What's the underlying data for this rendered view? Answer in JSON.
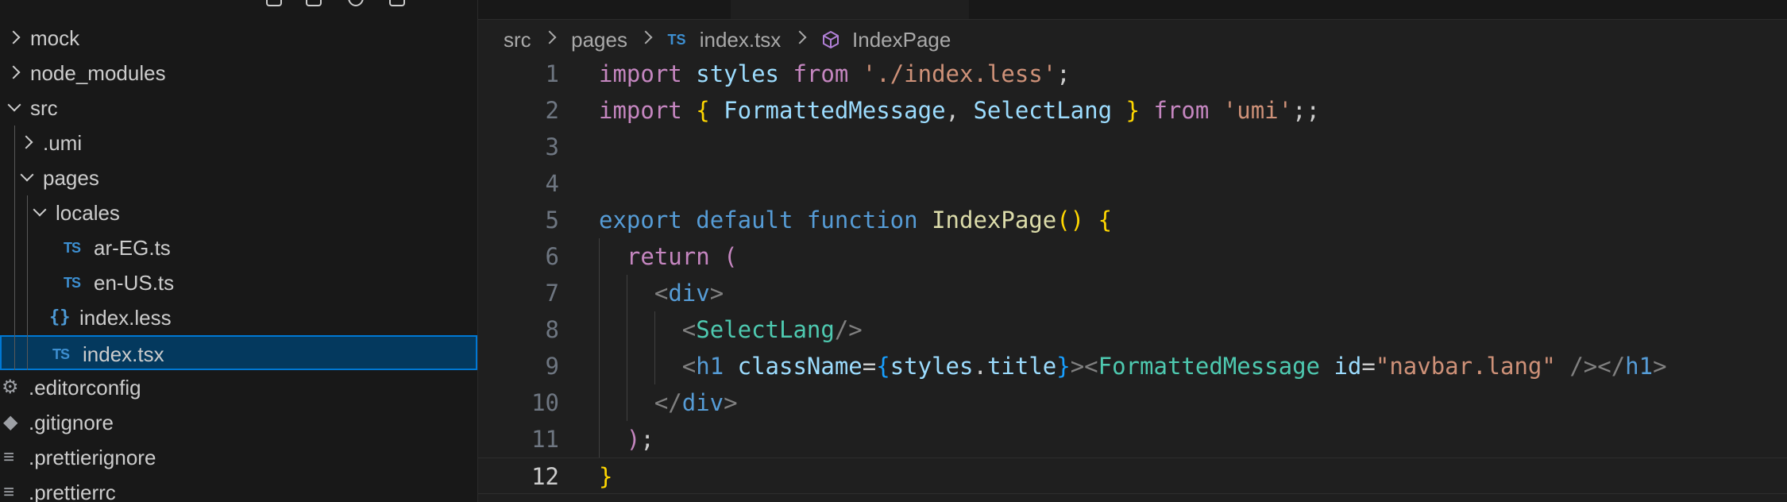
{
  "explorer": {
    "items": [
      {
        "label": "mock",
        "kind": "folder",
        "state": "closed",
        "depth": 0
      },
      {
        "label": "node_modules",
        "kind": "folder",
        "state": "closed",
        "depth": 0
      },
      {
        "label": "src",
        "kind": "folder",
        "state": "open",
        "depth": 0
      },
      {
        "label": ".umi",
        "kind": "folder",
        "state": "closed",
        "depth": 1
      },
      {
        "label": "pages",
        "kind": "folder",
        "state": "open",
        "depth": 1
      },
      {
        "label": "locales",
        "kind": "folder",
        "state": "open",
        "depth": 2
      },
      {
        "label": "ar-EG.ts",
        "kind": "ts-file",
        "depth": 3
      },
      {
        "label": "en-US.ts",
        "kind": "ts-file",
        "depth": 3
      },
      {
        "label": "index.less",
        "kind": "less-file",
        "depth": 2
      },
      {
        "label": "index.tsx",
        "kind": "ts-file",
        "depth": 2,
        "selected": true
      },
      {
        "label": ".editorconfig",
        "kind": "config-file",
        "depth": 0
      },
      {
        "label": ".gitignore",
        "kind": "git-file",
        "depth": 0
      },
      {
        "label": ".prettierignore",
        "kind": "text-file",
        "depth": 0
      },
      {
        "label": ".prettierrc",
        "kind": "text-file",
        "depth": 0
      }
    ],
    "icons": {
      "ts": "TS",
      "less": "{}"
    }
  },
  "breadcrumb": {
    "parts": [
      "src",
      "pages",
      "index.tsx",
      "IndexPage"
    ],
    "ts_badge": "TS"
  },
  "editor": {
    "current_line": 12,
    "line_numbers": [
      "1",
      "2",
      "3",
      "4",
      "5",
      "6",
      "7",
      "8",
      "9",
      "10",
      "11",
      "12"
    ],
    "lines": [
      [
        [
          "kw",
          "import"
        ],
        [
          "txt",
          " "
        ],
        [
          "var",
          "styles"
        ],
        [
          "txt",
          " "
        ],
        [
          "kw",
          "from"
        ],
        [
          "txt",
          " "
        ],
        [
          "str",
          "'./index.less'"
        ],
        [
          "txt",
          ";"
        ]
      ],
      [
        [
          "kw",
          "import"
        ],
        [
          "txt",
          " "
        ],
        [
          "brk",
          "{"
        ],
        [
          "txt",
          " "
        ],
        [
          "var",
          "FormattedMessage"
        ],
        [
          "txt",
          ", "
        ],
        [
          "var",
          "SelectLang"
        ],
        [
          "txt",
          " "
        ],
        [
          "brk",
          "}"
        ],
        [
          "txt",
          " "
        ],
        [
          "kw",
          "from"
        ],
        [
          "txt",
          " "
        ],
        [
          "str",
          "'umi'"
        ],
        [
          "txt",
          ";;"
        ]
      ],
      [],
      [],
      [
        [
          "kwb",
          "export"
        ],
        [
          "txt",
          " "
        ],
        [
          "kwb",
          "default"
        ],
        [
          "txt",
          " "
        ],
        [
          "kwb",
          "function"
        ],
        [
          "txt",
          " "
        ],
        [
          "fn",
          "IndexPage"
        ],
        [
          "brk",
          "()"
        ],
        [
          "txt",
          " "
        ],
        [
          "brk",
          "{"
        ]
      ],
      [
        [
          "txt",
          "  "
        ],
        [
          "kw",
          "return"
        ],
        [
          "txt",
          " "
        ],
        [
          "kw",
          "("
        ]
      ],
      [
        [
          "txt",
          "    "
        ],
        [
          "pun",
          "<"
        ],
        [
          "tagb",
          "div"
        ],
        [
          "pun",
          ">"
        ]
      ],
      [
        [
          "txt",
          "      "
        ],
        [
          "pun",
          "<"
        ],
        [
          "tag",
          "SelectLang"
        ],
        [
          "pun",
          "/>"
        ]
      ],
      [
        [
          "txt",
          "      "
        ],
        [
          "pun",
          "<"
        ],
        [
          "tagb",
          "h1"
        ],
        [
          "txt",
          " "
        ],
        [
          "var",
          "className"
        ],
        [
          "txt",
          "="
        ],
        [
          "brk2",
          "{"
        ],
        [
          "var",
          "styles"
        ],
        [
          "txt",
          "."
        ],
        [
          "var",
          "title"
        ],
        [
          "brk2",
          "}"
        ],
        [
          "pun",
          "><"
        ],
        [
          "tag",
          "FormattedMessage"
        ],
        [
          "txt",
          " "
        ],
        [
          "var",
          "id"
        ],
        [
          "txt",
          "="
        ],
        [
          "str",
          "\"navbar.lang\""
        ],
        [
          "txt",
          " "
        ],
        [
          "pun",
          "/></"
        ],
        [
          "tagb",
          "h1"
        ],
        [
          "pun",
          ">"
        ]
      ],
      [
        [
          "txt",
          "    "
        ],
        [
          "pun",
          "</"
        ],
        [
          "tagb",
          "div"
        ],
        [
          "pun",
          ">"
        ]
      ],
      [
        [
          "txt",
          "  "
        ],
        [
          "kw",
          ")"
        ],
        [
          "txt",
          ";"
        ]
      ],
      [
        [
          "brk",
          "}"
        ]
      ]
    ]
  },
  "colors": {
    "sidebar_bg": "#181818",
    "editor_bg": "#1f1f1f",
    "selection_bg": "#04395e",
    "selection_border": "#0078d4",
    "keyword": "#c586c0",
    "storage": "#569cd6",
    "variable": "#9cdcfe",
    "string": "#ce9178",
    "function": "#dcdcaa",
    "component": "#4ec9b0"
  }
}
